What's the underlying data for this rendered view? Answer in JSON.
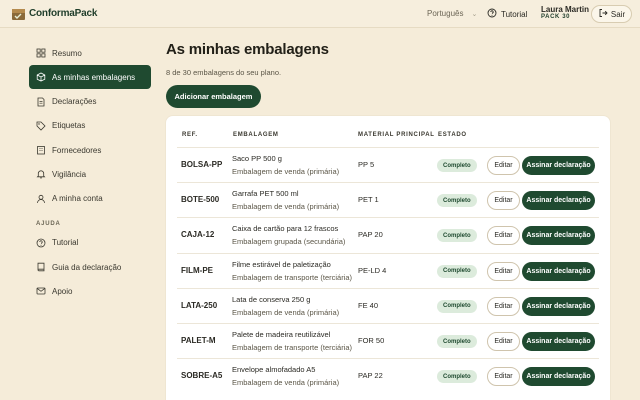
{
  "brand": {
    "name": "ConformaPack",
    "accent": "#1f4a30",
    "background": "#f5ecd9"
  },
  "header": {
    "language": "Português",
    "tutorial_label": "Tutorial",
    "user_name": "Laura Martin",
    "user_plan": "PACK 30",
    "logout_label": "Sair"
  },
  "sidebar": {
    "items": [
      {
        "label": "Resumo",
        "icon": "grid-icon",
        "active": false
      },
      {
        "label": "As minhas embalagens",
        "icon": "box-icon",
        "active": true
      },
      {
        "label": "Declarações",
        "icon": "document-icon",
        "active": false
      },
      {
        "label": "Etiquetas",
        "icon": "tag-icon",
        "active": false
      },
      {
        "label": "Fornecedores",
        "icon": "building-icon",
        "active": false
      },
      {
        "label": "Vigilância",
        "icon": "bell-icon",
        "active": false
      },
      {
        "label": "A minha conta",
        "icon": "user-icon",
        "active": false
      }
    ],
    "help_section": "AJUDA",
    "help_items": [
      {
        "label": "Tutorial",
        "icon": "help-circle-icon"
      },
      {
        "label": "Guia da declaração",
        "icon": "book-icon"
      },
      {
        "label": "Apoio",
        "icon": "mail-icon"
      }
    ]
  },
  "main": {
    "title": "As minhas embalagens",
    "subtitle": "8 de 30 embalagens do seu plano.",
    "add_button": "Adicionar embalagem",
    "table": {
      "headers": {
        "ref": "REF.",
        "pkg": "EMBALAGEM",
        "material": "MATERIAL PRINCIPAL",
        "status": "ESTADO"
      },
      "rows": [
        {
          "ref": "BOLSA-PP",
          "name": "Saco PP 500 g",
          "type": "Embalagem de venda (primária)",
          "material": "PP 5",
          "status": "Completo",
          "edit": "Editar",
          "sign": "Assinar declaração"
        },
        {
          "ref": "BOTE-500",
          "name": "Garrafa PET 500 ml",
          "type": "Embalagem de venda (primária)",
          "material": "PET 1",
          "status": "Completo",
          "edit": "Editar",
          "sign": "Assinar declaração"
        },
        {
          "ref": "CAJA-12",
          "name": "Caixa de cartão para 12 frascos",
          "type": "Embalagem grupada (secundária)",
          "material": "PAP 20",
          "status": "Completo",
          "edit": "Editar",
          "sign": "Assinar declaração"
        },
        {
          "ref": "FILM-PE",
          "name": "Filme estirável de paletização",
          "type": "Embalagem de transporte (terciária)",
          "material": "PE-LD 4",
          "status": "Completo",
          "edit": "Editar",
          "sign": "Assinar declaração"
        },
        {
          "ref": "LATA-250",
          "name": "Lata de conserva 250 g",
          "type": "Embalagem de venda (primária)",
          "material": "FE 40",
          "status": "Completo",
          "edit": "Editar",
          "sign": "Assinar declaração"
        },
        {
          "ref": "PALET-M",
          "name": "Palete de madeira reutilizável",
          "type": "Embalagem de transporte (terciária)",
          "material": "FOR 50",
          "status": "Completo",
          "edit": "Editar",
          "sign": "Assinar declaração"
        },
        {
          "ref": "SOBRE-A5",
          "name": "Envelope almofadado A5",
          "type": "Embalagem de venda (primária)",
          "material": "PAP 22",
          "status": "Completo",
          "edit": "Editar",
          "sign": "Assinar declaração"
        }
      ]
    }
  }
}
